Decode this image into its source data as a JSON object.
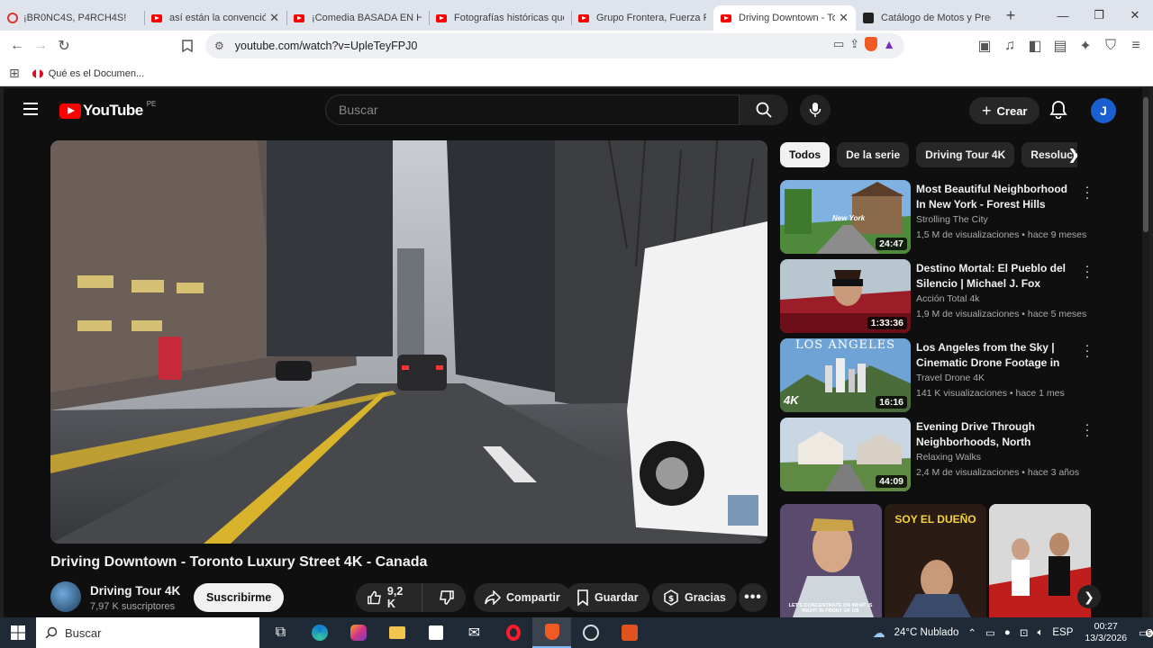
{
  "browser": {
    "tabs": [
      {
        "title": "¡BR0NC4S, P4RCH4S!",
        "active": false
      },
      {
        "title": "así están la convención",
        "active": false
      },
      {
        "title": "¡Comedia BASADA EN HECHOS",
        "active": false
      },
      {
        "title": "Fotografías históricas que",
        "active": false
      },
      {
        "title": "Grupo Frontera, Fuerza Regida",
        "active": false
      },
      {
        "title": "Driving Downtown - Toronto",
        "active": true
      },
      {
        "title": "Catálogo de Motos y Precios",
        "active": false
      }
    ],
    "url": "youtube.com/watch?v=UpleTeyFPJ0",
    "bookmark": "Qué es el Documen..."
  },
  "youtube": {
    "logo_text": "YouTube",
    "country": "PE",
    "search_placeholder": "Buscar",
    "create_label": "Crear",
    "avatar_letter": "J"
  },
  "video": {
    "title": "Driving Downtown - Toronto Luxury Street 4K - Canada",
    "channel": "Driving Tour 4K",
    "subscribers": "7,97 K suscriptores",
    "subscribe_label": "Suscribirme",
    "likes": "9,2 K",
    "share_label": "Compartir",
    "save_label": "Guardar",
    "thanks_label": "Gracias"
  },
  "sidebar": {
    "chips": [
      "Todos",
      "De la serie",
      "Driving Tour 4K",
      "Resolución"
    ],
    "recommendations": [
      {
        "title": "Most Beautiful Neighborhood In New York - Forest Hills",
        "channel": "Strolling The City",
        "meta": "1,5 M de visualizaciones • hace 9 meses",
        "duration": "24:47",
        "thumb_text": "New York"
      },
      {
        "title": "Destino Mortal: El Pueblo del Silencio | Michael J. Fox",
        "channel": "Acción Total 4k",
        "meta": "1,9 M de visualizaciones • hace 5 meses",
        "duration": "1:33:36",
        "thumb_text": ""
      },
      {
        "title": "Los Angeles from the Sky | Cinematic Drone Footage in 4K",
        "channel": "Travel Drone 4K",
        "meta": "141 K visualizaciones • hace 1 mes",
        "duration": "16:16",
        "thumb_text": "LOS ANGELES"
      },
      {
        "title": "Evening Drive Through Neighborhoods, North Carolin...",
        "channel": "Relaxing Walks",
        "meta": "2,4 M de visualizaciones • hace 3 años",
        "duration": "44:09",
        "thumb_text": ""
      }
    ],
    "shorts": [
      {
        "caption": "LET'S CONCENTRATE ON WHAT IS RIGHT IN FRONT OF US"
      },
      {
        "caption": "SOY EL DUEÑO"
      },
      {
        "caption": ""
      }
    ]
  },
  "taskbar": {
    "search_label": "Buscar",
    "weather": "24°C Nublado",
    "language": "ESP",
    "time": "00:27",
    "date": "13/3/2026",
    "notifications": "5"
  }
}
